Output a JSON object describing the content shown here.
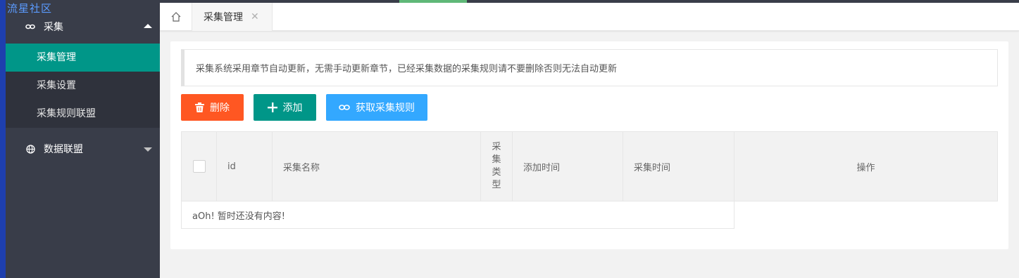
{
  "logo": "流星社区",
  "sidebar": {
    "groups": [
      {
        "label": "采集",
        "icon": "link-icon",
        "expanded": true,
        "items": [
          {
            "label": "采集管理",
            "active": true
          },
          {
            "label": "采集设置",
            "active": false
          },
          {
            "label": "采集规则联盟",
            "active": false
          }
        ]
      },
      {
        "label": "数据联盟",
        "icon": "globe-icon",
        "expanded": false
      }
    ]
  },
  "tabs": [
    {
      "label": "采集管理",
      "close": "✕"
    }
  ],
  "notice": "采集系统采用章节自动更新，无需手动更新章节，已经采集数据的采集规则请不要删除否则无法自动更新",
  "toolbar": {
    "delete_label": "删除",
    "add_label": "添加",
    "get_rules_label": "获取采集规则"
  },
  "table": {
    "columns": [
      "id",
      "采集名称",
      "采集类型",
      "添加时间",
      "采集时间",
      "操作"
    ],
    "empty_text": "aOh! 暂时还没有内容!"
  },
  "colors": {
    "sidebar_bg": "#393d49",
    "active": "#009688",
    "danger": "#ff5722",
    "info": "#1e9fff"
  }
}
